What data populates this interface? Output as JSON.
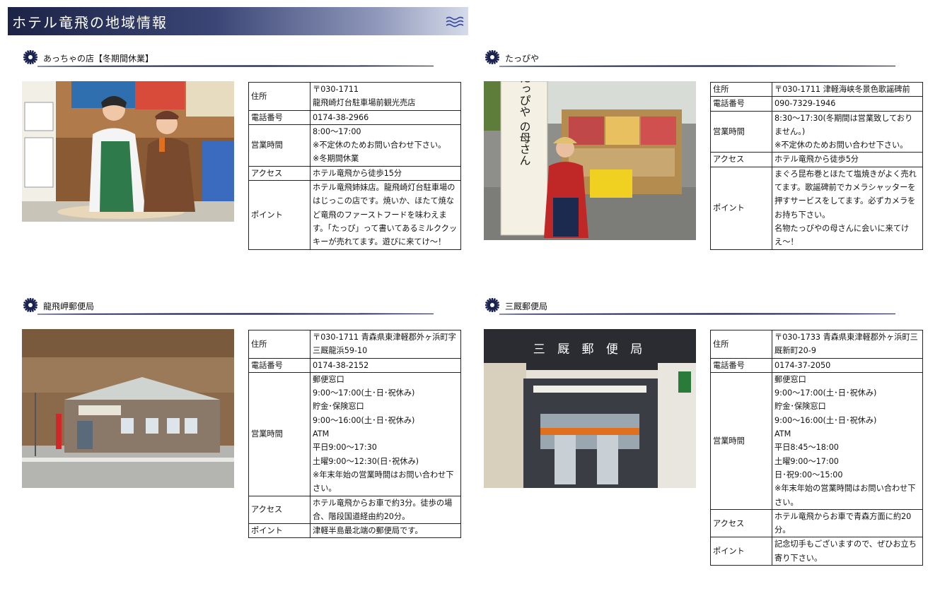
{
  "banner": {
    "title": "ホテル竜飛の地域情報"
  },
  "sections": [
    {
      "title": "あっちゃの店【冬期間休業】",
      "photo_icon": "photo-shop-staff",
      "rows": [
        {
          "label": "住所",
          "value": "〒030-1711\n龍飛崎灯台駐車場前観光売店"
        },
        {
          "label": "電話番号",
          "value": "0174-38-2966"
        },
        {
          "label": "営業時間",
          "value": "8:00〜17:00\n※不定休のためお問い合わせ下さい。\n※冬期間休業"
        },
        {
          "label": "アクセス",
          "value": "ホテル竜飛から徒歩15分"
        },
        {
          "label": "ポイント",
          "value": "ホテル竜飛姉妹店。龍飛崎灯台駐車場のはじっこの店です。焼いか、ほたて焼など竜飛のファーストフードを味わえます。「たっぴ」って書いてあるミルククッキーが売れてます。遊びに来てけ〜！"
        }
      ]
    },
    {
      "title": "たっぴや",
      "photo_icon": "photo-tappiya-stall",
      "sign_text": "名物 たっぴや の母さん",
      "rows": [
        {
          "label": "住所",
          "value": "〒030-1711 津軽海峡冬景色歌謡碑前"
        },
        {
          "label": "電話番号",
          "value": "090-7329-1946"
        },
        {
          "label": "営業時間",
          "value": "8:30〜17:30(冬期間は営業致しておりません。)\n※不定休のためお問い合わせ下さい。"
        },
        {
          "label": "アクセス",
          "value": "ホテル竜飛から徒歩5分"
        },
        {
          "label": "ポイント",
          "value": "まぐろ昆布巻とほたて塩焼きがよく売れてます。歌謡碑前でカメラシャッターを押すサービスをしてます。必ずカメラをお持ち下さい。\n名物たっぴやの母さんに会いに来てけえ〜！"
        }
      ]
    },
    {
      "title": "龍飛岬郵便局",
      "photo_icon": "photo-tappi-post-office",
      "rows": [
        {
          "label": "住所",
          "value": "〒030-1711 青森県東津軽郡外ヶ浜町字三厩龍浜59-10"
        },
        {
          "label": "電話番号",
          "value": "0174-38-2152"
        },
        {
          "label": "営業時間",
          "value": "郵便窓口\n9:00〜17:00(土･日･祝休み)\n貯金･保険窓口\n9:00〜16:00(土･日･祝休み)\nATM\n平日9:00〜17:30\n土曜9:00〜12:30(日･祝休み)\n※年末年始の営業時間はお問い合わせ下さい。"
        },
        {
          "label": "アクセス",
          "value": "ホテル竜飛からお車で約3分。徒歩の場合、階段国道経由約20分。"
        },
        {
          "label": "ポイント",
          "value": "津軽半島最北端の郵便局です。"
        }
      ]
    },
    {
      "title": "三厩郵便局",
      "photo_icon": "photo-minmaya-post-office",
      "sign_text": "三 厩 郵 便 局",
      "rows": [
        {
          "label": "住所",
          "value": "〒030-1733 青森県東津軽郡外ヶ浜町三厩新町20-9"
        },
        {
          "label": "電話番号",
          "value": "0174-37-2050"
        },
        {
          "label": "営業時間",
          "value": "郵便窓口\n9:00〜17:00(土･日･祝休み)\n貯金･保険窓口\n9:00〜16:00(土･日･祝休み)\nATM\n平日8:45〜18:00\n土曜9:00〜17:00\n日･祝9:00〜15:00\n※年末年始の営業時間はお問い合わせ下さい。"
        },
        {
          "label": "アクセス",
          "value": "ホテル竜飛からお車で青森方面に約20分。"
        },
        {
          "label": "ポイント",
          "value": "記念切手もございますので、ぜひお立ち寄り下さい。"
        }
      ]
    }
  ]
}
